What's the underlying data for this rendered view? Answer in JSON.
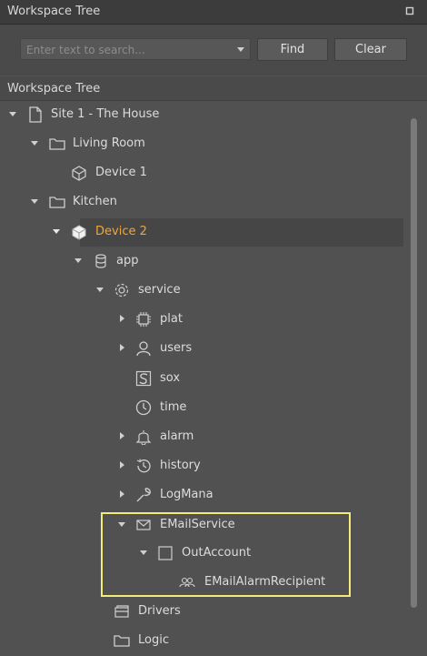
{
  "panel": {
    "title": "Workspace Tree"
  },
  "toolbar": {
    "search_placeholder": "Enter text to search...",
    "find_label": "Find",
    "clear_label": "Clear"
  },
  "tree": {
    "header": "Workspace Tree",
    "selected_color": "#f0a53a",
    "highlight_color": "#f3ec7a",
    "nodes": [
      {
        "label": "Site 1 - The House",
        "icon": "file-icon",
        "expanded": true
      },
      {
        "label": "Living Room",
        "icon": "folder-icon",
        "expanded": true
      },
      {
        "label": "Device 1",
        "icon": "device-icon"
      },
      {
        "label": "Kitchen",
        "icon": "folder-icon",
        "expanded": true
      },
      {
        "label": "Device 2",
        "icon": "device-icon",
        "expanded": true,
        "selected": true
      },
      {
        "label": "app",
        "icon": "database-icon",
        "expanded": true
      },
      {
        "label": "service",
        "icon": "gear-icon",
        "expanded": true
      },
      {
        "label": "plat",
        "icon": "chip-icon",
        "expanded": false
      },
      {
        "label": "users",
        "icon": "user-icon",
        "expanded": false
      },
      {
        "label": "sox",
        "icon": "sox-icon"
      },
      {
        "label": "time",
        "icon": "clock-icon"
      },
      {
        "label": "alarm",
        "icon": "bell-icon",
        "expanded": false
      },
      {
        "label": "history",
        "icon": "history-icon",
        "expanded": false
      },
      {
        "label": "LogMana",
        "icon": "wrench-icon",
        "expanded": false
      },
      {
        "label": "EMailService",
        "icon": "mail-icon",
        "expanded": true
      },
      {
        "label": "OutAccount",
        "icon": "account-icon",
        "expanded": true
      },
      {
        "label": "EMailAlarmRecipient",
        "icon": "people-icon"
      },
      {
        "label": "Drivers",
        "icon": "drivers-icon"
      },
      {
        "label": "Logic",
        "icon": "folder-icon"
      }
    ]
  }
}
